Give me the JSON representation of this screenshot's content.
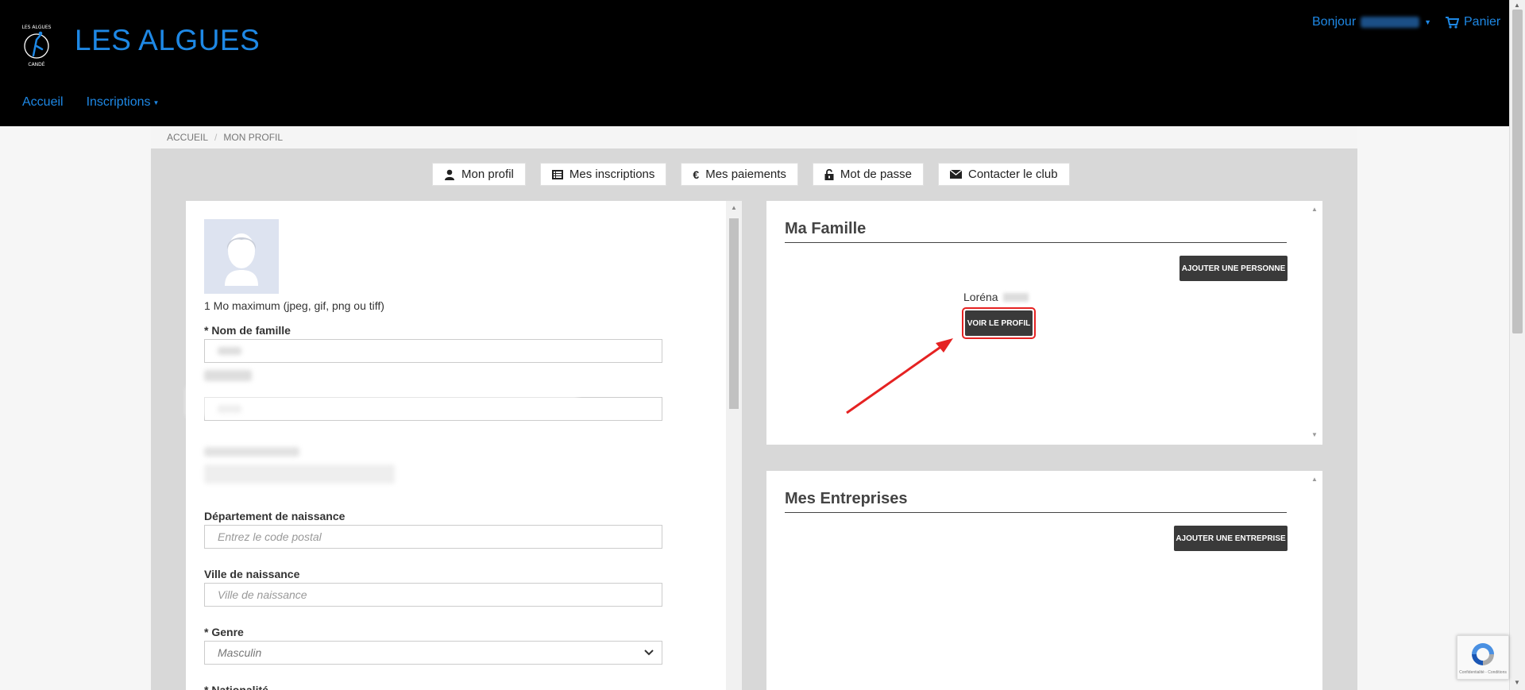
{
  "header": {
    "site_title": "LES ALGUES",
    "logo_top_text": "LES ALGUES",
    "logo_bottom_text": "CANDÉ",
    "greeting_label": "Bonjour",
    "cart_label": "Panier",
    "brand_color": "#1e88e5"
  },
  "nav": {
    "items": [
      {
        "label": "Accueil"
      },
      {
        "label": "Inscriptions"
      }
    ]
  },
  "breadcrumb": {
    "items": [
      "Accueil",
      "Mon profil"
    ],
    "separator": "/"
  },
  "tabs": [
    {
      "label": "Mon profil",
      "icon": "user-icon"
    },
    {
      "label": "Mes inscriptions",
      "icon": "list-icon"
    },
    {
      "label": "Mes paiements",
      "icon": "euro-icon"
    },
    {
      "label": "Mot de passe",
      "icon": "unlock-icon"
    },
    {
      "label": "Contacter le club",
      "icon": "envelope-icon"
    }
  ],
  "profile_form": {
    "photo_hint": "1 Mo maximum (jpeg, gif, png ou tiff)",
    "last_name_label": "* Nom de famille",
    "birth_department_label": "Département de naissance",
    "birth_department_placeholder": "Entrez le code postal",
    "birth_city_label": "Ville de naissance",
    "birth_city_placeholder": "Ville de naissance",
    "gender_label": "* Genre",
    "gender_value": "Masculin",
    "nationality_label": "* Nationalité"
  },
  "family_panel": {
    "title": "Ma Famille",
    "add_button": "Ajouter une personne",
    "member_first_name": "Loréna",
    "view_profile_button": "Voir le profil",
    "highlight_color": "#e52222"
  },
  "companies_panel": {
    "title": "Mes Entreprises",
    "add_button": "Ajouter une entreprise"
  },
  "recaptcha": {
    "footer_text": "Confidentialité - Conditions"
  }
}
